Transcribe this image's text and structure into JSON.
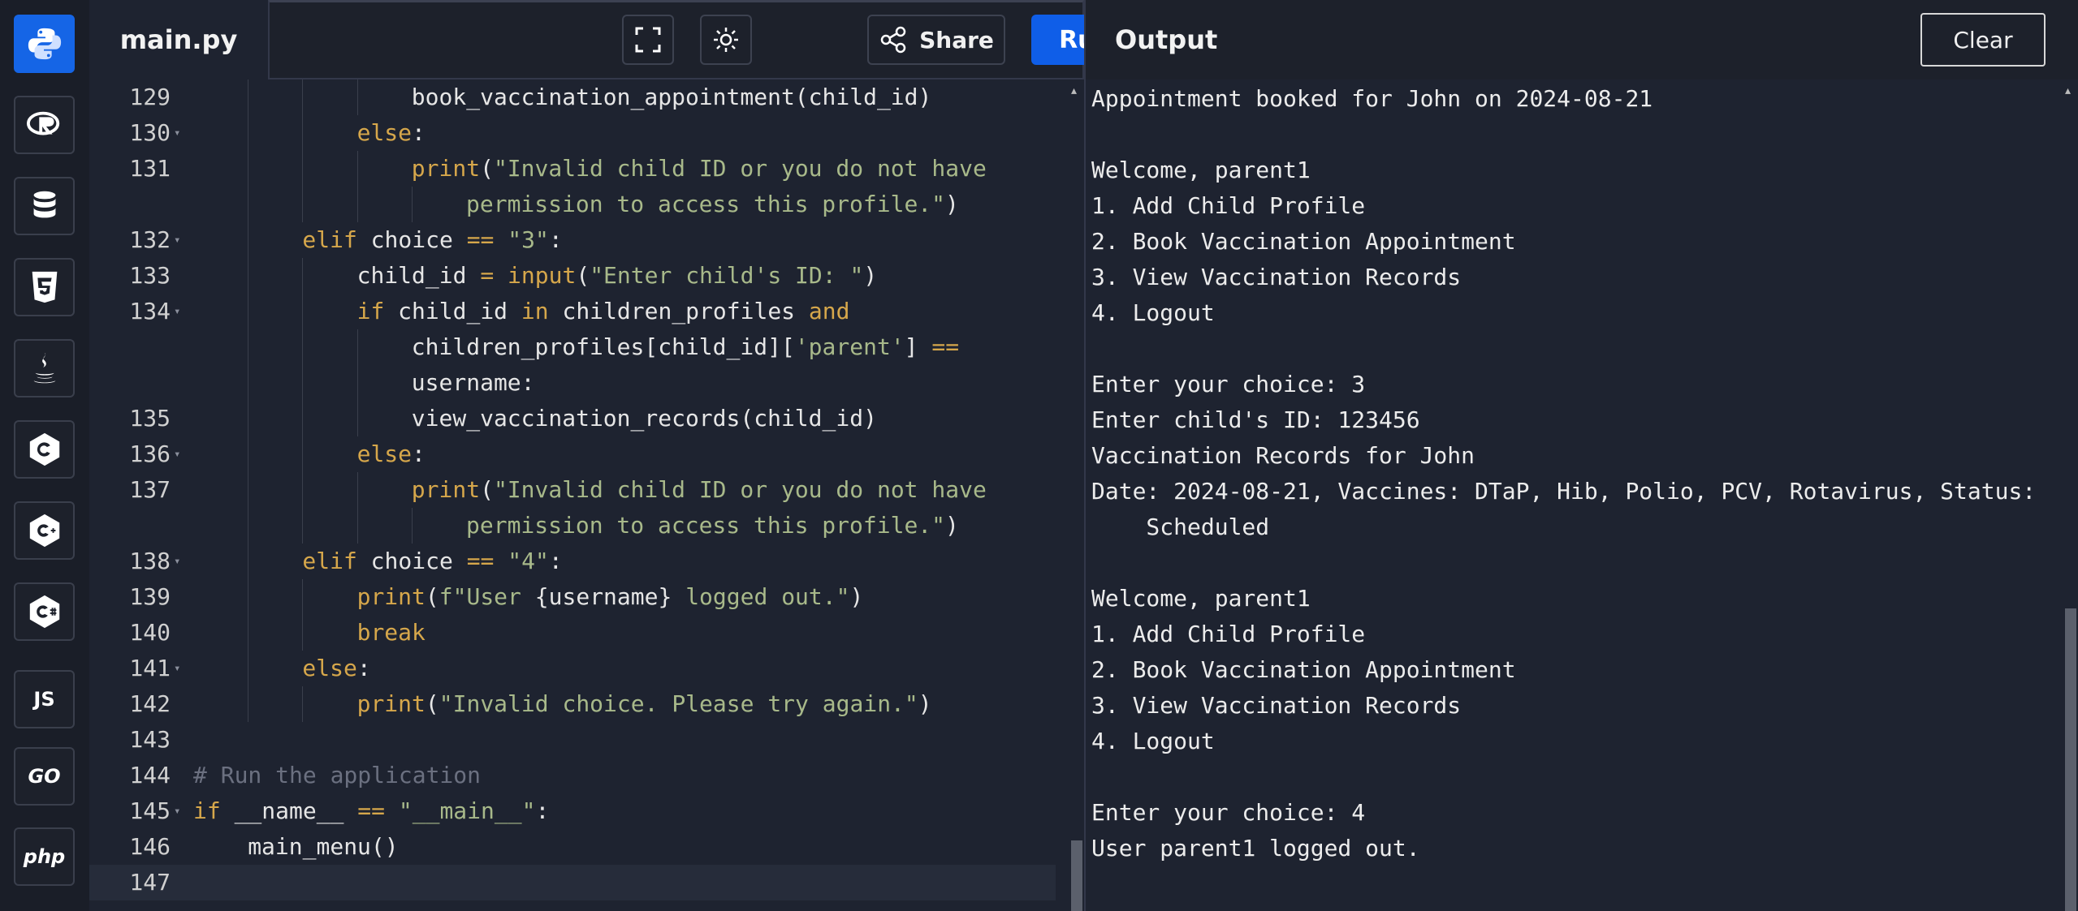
{
  "sidebar": {
    "languages": [
      {
        "name": "python-icon"
      },
      {
        "name": "r-icon"
      },
      {
        "name": "database-icon"
      },
      {
        "name": "html5-icon"
      },
      {
        "name": "java-icon"
      },
      {
        "name": "c-icon"
      },
      {
        "name": "cpp-icon"
      },
      {
        "name": "csharp-icon"
      },
      {
        "name": "javascript-icon",
        "label": "JS"
      },
      {
        "name": "go-icon",
        "label": "GO"
      },
      {
        "name": "php-icon",
        "label": "php"
      }
    ]
  },
  "editor": {
    "filename": "main.py",
    "share_label": "Share",
    "run_label": "Run"
  },
  "output": {
    "title": "Output",
    "clear_label": "Clear",
    "lines": [
      "Appointment booked for John on 2024-08-21",
      "",
      "Welcome, parent1",
      "1. Add Child Profile",
      "2. Book Vaccination Appointment",
      "3. View Vaccination Records",
      "4. Logout",
      "",
      "Enter your choice: 3",
      "Enter child's ID: 123456",
      "Vaccination Records for John",
      "Date: 2024-08-21, Vaccines: DTaP, Hib, Polio, PCV, Rotavirus, Status:",
      "    Scheduled",
      "",
      "Welcome, parent1",
      "1. Add Child Profile",
      "2. Book Vaccination Appointment",
      "3. View Vaccination Records",
      "4. Logout",
      "",
      "Enter your choice: 4",
      "User parent1 logged out."
    ]
  },
  "code": {
    "lines": [
      {
        "n": "129",
        "fold": false,
        "indent": 4,
        "tokens": [
          [
            "fn",
            "book_vaccination_appointment(child_id)"
          ]
        ]
      },
      {
        "n": "130",
        "fold": true,
        "indent": 3,
        "tokens": [
          [
            "kw",
            "else"
          ],
          [
            "fn",
            ":"
          ]
        ]
      },
      {
        "n": "131",
        "fold": false,
        "indent": 4,
        "tokens": [
          [
            "kw",
            "print"
          ],
          [
            "fn",
            "("
          ],
          [
            "str",
            "\"Invalid child ID or you do not have"
          ]
        ]
      },
      {
        "n": "",
        "fold": false,
        "indent": 5,
        "tokens": [
          [
            "str",
            "permission to access this profile.\""
          ],
          [
            "fn",
            ")"
          ]
        ]
      },
      {
        "n": "132",
        "fold": true,
        "indent": 2,
        "tokens": [
          [
            "kw",
            "elif"
          ],
          [
            "fn",
            " choice "
          ],
          [
            "kw",
            "=="
          ],
          [
            "fn",
            " "
          ],
          [
            "str",
            "\"3\""
          ],
          [
            "fn",
            ":"
          ]
        ]
      },
      {
        "n": "133",
        "fold": false,
        "indent": 3,
        "tokens": [
          [
            "fn",
            "child_id "
          ],
          [
            "kw",
            "="
          ],
          [
            "fn",
            " "
          ],
          [
            "kw",
            "input"
          ],
          [
            "fn",
            "("
          ],
          [
            "str",
            "\"Enter child's ID: \""
          ],
          [
            "fn",
            ")"
          ]
        ]
      },
      {
        "n": "134",
        "fold": true,
        "indent": 3,
        "tokens": [
          [
            "kw",
            "if"
          ],
          [
            "fn",
            " child_id "
          ],
          [
            "kw",
            "in"
          ],
          [
            "fn",
            " children_profiles "
          ],
          [
            "kw",
            "and"
          ]
        ]
      },
      {
        "n": "",
        "fold": false,
        "indent": 4,
        "tokens": [
          [
            "fn",
            "children_profiles[child_id]["
          ],
          [
            "str",
            "'parent'"
          ],
          [
            "fn",
            "] "
          ],
          [
            "kw",
            "=="
          ]
        ]
      },
      {
        "n": "",
        "fold": false,
        "indent": 4,
        "tokens": [
          [
            "fn",
            "username:"
          ]
        ]
      },
      {
        "n": "135",
        "fold": false,
        "indent": 4,
        "tokens": [
          [
            "fn",
            "view_vaccination_records(child_id)"
          ]
        ]
      },
      {
        "n": "136",
        "fold": true,
        "indent": 3,
        "tokens": [
          [
            "kw",
            "else"
          ],
          [
            "fn",
            ":"
          ]
        ]
      },
      {
        "n": "137",
        "fold": false,
        "indent": 4,
        "tokens": [
          [
            "kw",
            "print"
          ],
          [
            "fn",
            "("
          ],
          [
            "str",
            "\"Invalid child ID or you do not have"
          ]
        ]
      },
      {
        "n": "",
        "fold": false,
        "indent": 5,
        "tokens": [
          [
            "str",
            "permission to access this profile.\""
          ],
          [
            "fn",
            ")"
          ]
        ]
      },
      {
        "n": "138",
        "fold": true,
        "indent": 2,
        "tokens": [
          [
            "kw",
            "elif"
          ],
          [
            "fn",
            " choice "
          ],
          [
            "kw",
            "=="
          ],
          [
            "fn",
            " "
          ],
          [
            "str",
            "\"4\""
          ],
          [
            "fn",
            ":"
          ]
        ]
      },
      {
        "n": "139",
        "fold": false,
        "indent": 3,
        "tokens": [
          [
            "kw",
            "print"
          ],
          [
            "fn",
            "("
          ],
          [
            "str",
            "f\"User "
          ],
          [
            "fn",
            "{username}"
          ],
          [
            "str",
            " logged out.\""
          ],
          [
            "fn",
            ")"
          ]
        ]
      },
      {
        "n": "140",
        "fold": false,
        "indent": 3,
        "tokens": [
          [
            "kw",
            "break"
          ]
        ]
      },
      {
        "n": "141",
        "fold": true,
        "indent": 2,
        "tokens": [
          [
            "kw",
            "else"
          ],
          [
            "fn",
            ":"
          ]
        ]
      },
      {
        "n": "142",
        "fold": false,
        "indent": 3,
        "tokens": [
          [
            "kw",
            "print"
          ],
          [
            "fn",
            "("
          ],
          [
            "str",
            "\"Invalid choice. Please try again.\""
          ],
          [
            "fn",
            ")"
          ]
        ]
      },
      {
        "n": "143",
        "fold": false,
        "indent": 0,
        "tokens": []
      },
      {
        "n": "144",
        "fold": false,
        "indent": 0,
        "tokens": [
          [
            "cm",
            "# Run the application"
          ]
        ]
      },
      {
        "n": "145",
        "fold": true,
        "indent": 0,
        "tokens": [
          [
            "kw",
            "if"
          ],
          [
            "fn",
            " __name__ "
          ],
          [
            "kw",
            "=="
          ],
          [
            "fn",
            " "
          ],
          [
            "str",
            "\"__main__\""
          ],
          [
            "fn",
            ":"
          ]
        ]
      },
      {
        "n": "146",
        "fold": false,
        "indent": 1,
        "tokens": [
          [
            "fn",
            "main_menu()"
          ]
        ]
      },
      {
        "n": "147",
        "fold": false,
        "indent": 0,
        "tokens": [],
        "current": true
      }
    ]
  }
}
